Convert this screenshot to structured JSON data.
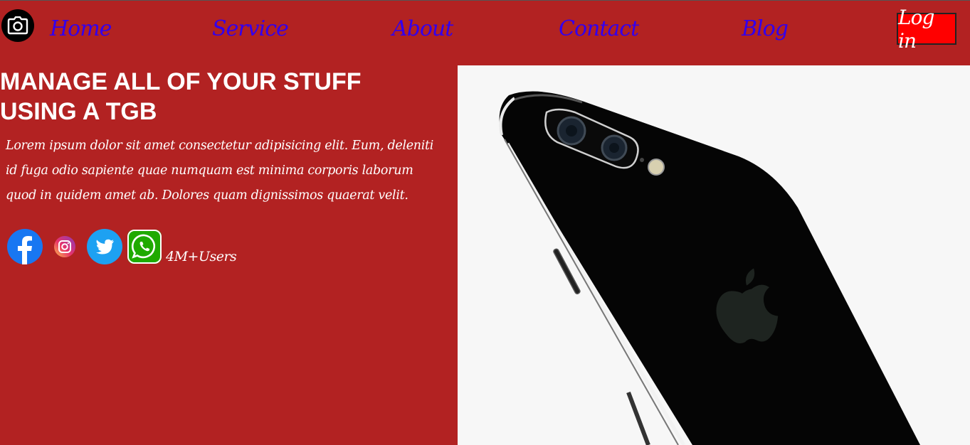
{
  "nav": {
    "logo_icon": "camera-icon",
    "items": [
      {
        "label": "Home"
      },
      {
        "label": "Service"
      },
      {
        "label": "About"
      },
      {
        "label": "Contact"
      },
      {
        "label": "Blog"
      }
    ],
    "login_label": "Log in"
  },
  "hero": {
    "title_line1": "MANAGE ALL OF YOUR STUFF",
    "title_line2": "USING A TGB",
    "text": "Lorem ipsum dolor sit amet consectetur adipisicing elit. Eum, deleniti id fuga odio sapiente quae numquam est minima corporis laborum quod in quidem amet ab. Dolores quam dignissimos quaerat velit.",
    "social_icons": [
      "facebook-icon",
      "instagram-icon",
      "twitter-icon",
      "whatsapp-icon"
    ],
    "users_label": "4M+Users",
    "image_icon": "smartphone-image"
  },
  "colors": {
    "background": "#b22222",
    "nav_link": "#3300ee",
    "login_bg": "#ff0000",
    "text": "#ffffff",
    "image_bg": "#f7f7f7"
  }
}
